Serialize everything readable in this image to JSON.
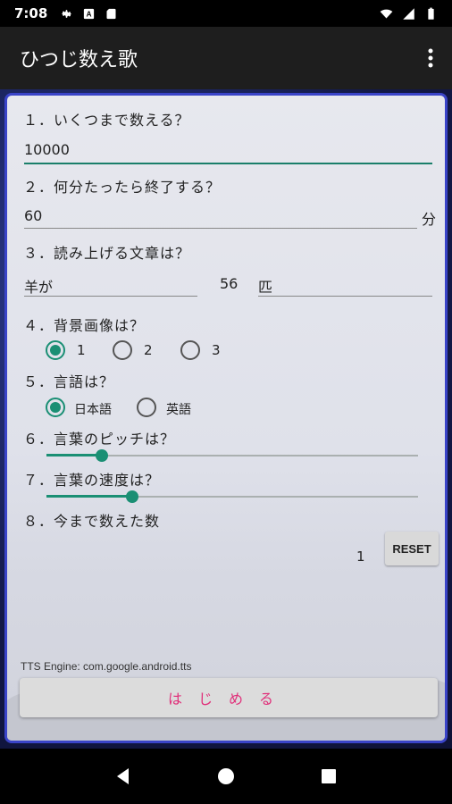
{
  "status": {
    "time": "7:08",
    "left_icons": [
      "gear-icon",
      "a-badge-icon",
      "sd-card-icon"
    ],
    "right_icons": [
      "wifi-icon",
      "signal-icon",
      "battery-icon"
    ]
  },
  "app": {
    "title": "ひつじ数え歌",
    "menu_icon": "more-vert-icon"
  },
  "questions": {
    "q1": "１．いくつまで数える？",
    "q2": "２．何分たったら終了する？",
    "q3": "３．読み上げる文章は？",
    "q4": "４．背景画像は？",
    "q5": "５．言語は？",
    "q6": "６．言葉のピッチは？",
    "q7": "７．言葉の速度は？",
    "q8": "８．今まで数えた数"
  },
  "fields": {
    "count_limit": "10000",
    "minutes": "60",
    "minutes_unit": "分",
    "phrase": "羊が",
    "phrase_number": "56",
    "phrase_suffix": "匹"
  },
  "background_options": {
    "options": [
      "1",
      "2",
      "3"
    ],
    "selected": "1"
  },
  "language_options": {
    "options": [
      "日本語",
      "英語"
    ],
    "selected": "日本語"
  },
  "sliders": {
    "pitch_level": 0.15,
    "speed_level": 0.23
  },
  "counted": {
    "value": "1",
    "reset_label": "RESET"
  },
  "footer": {
    "tts_engine": "TTS Engine: com.google.android.tts",
    "start_label": "はじめる"
  },
  "colors": {
    "accent": "#1a8f74",
    "start_text": "#e0307a",
    "card_border": "#3a44c8"
  }
}
